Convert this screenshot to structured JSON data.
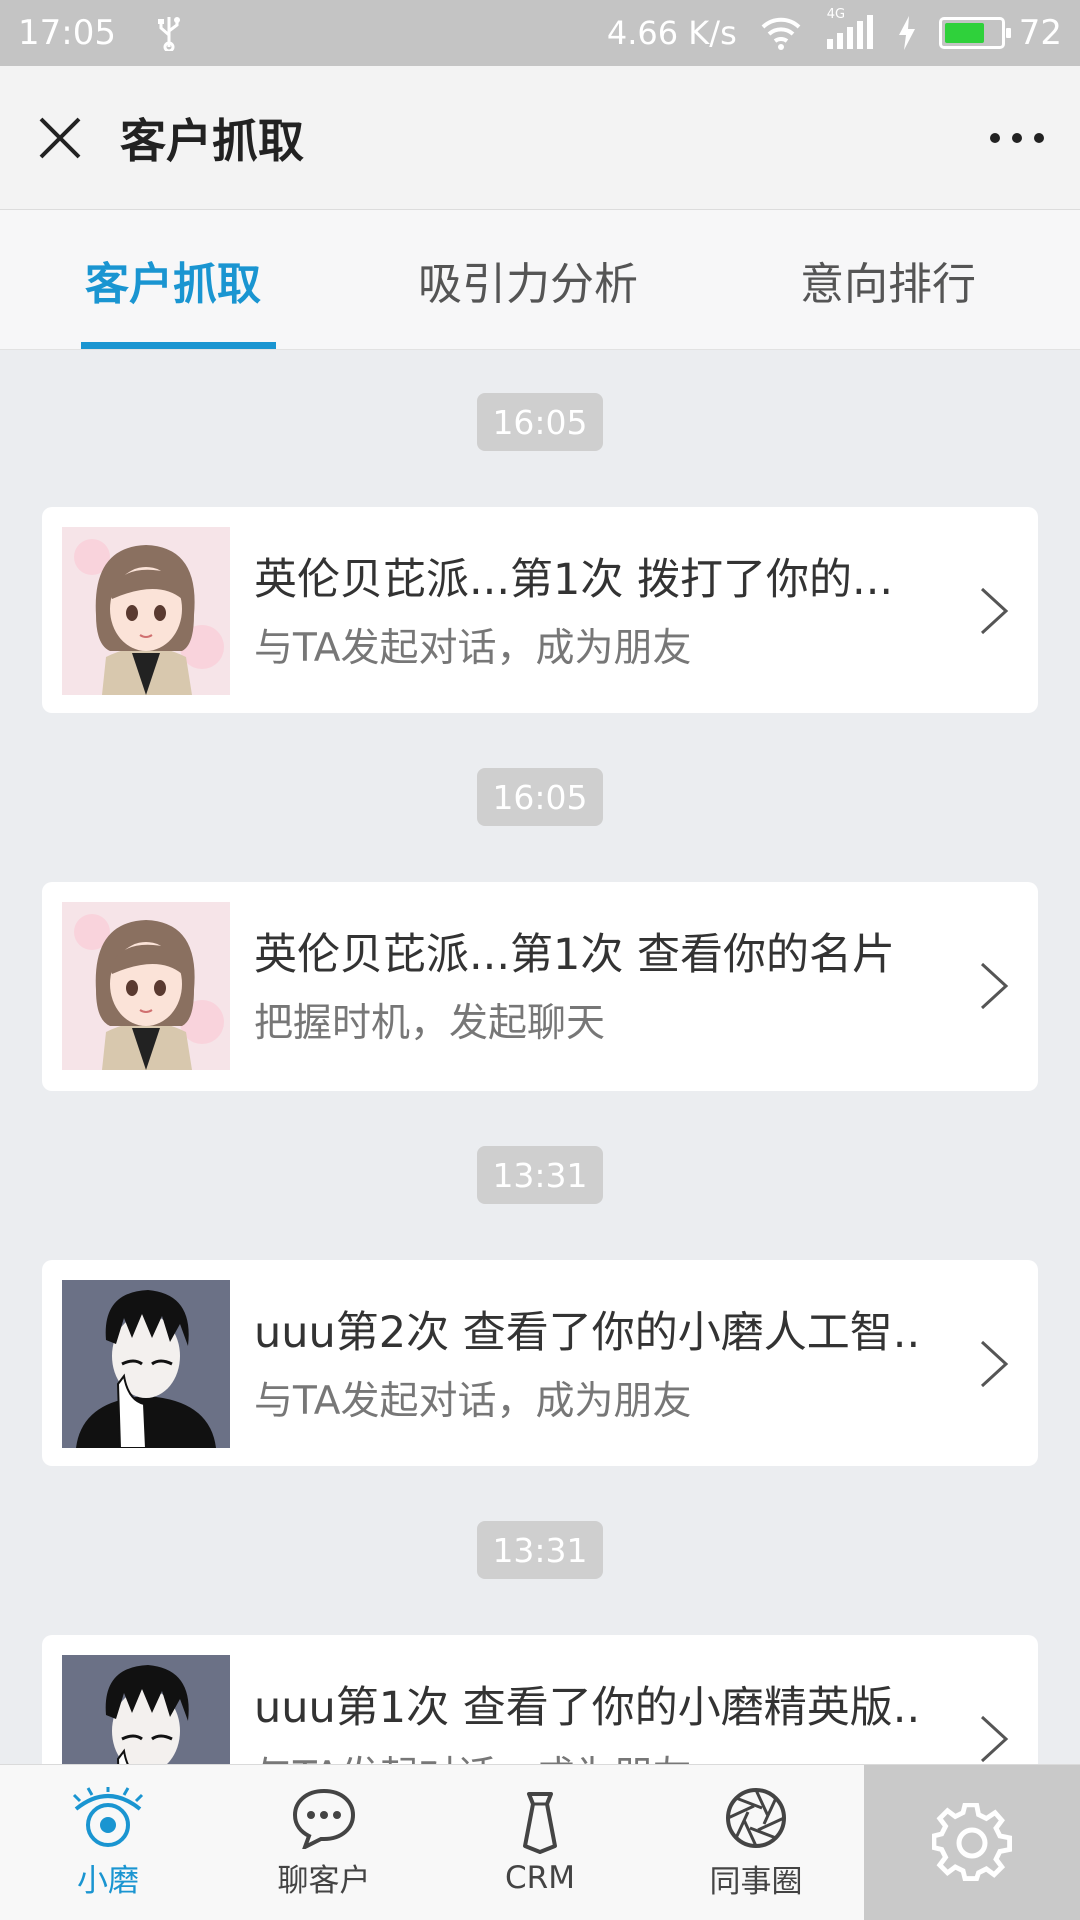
{
  "status_bar": {
    "time": "17:05",
    "net_speed": "4.66 K/s",
    "network_type": "4G",
    "battery": "72",
    "battery_level_percent": 72,
    "icons": [
      "usb-icon",
      "wifi-icon",
      "signal-icon",
      "charging-icon",
      "battery-icon"
    ]
  },
  "header": {
    "title": "客户抓取",
    "close_icon": "close-icon",
    "more_icon": "more-icon"
  },
  "tabs": [
    {
      "label": "客户抓取",
      "active": true
    },
    {
      "label": "吸引力分析",
      "active": false
    },
    {
      "label": "意向排行",
      "active": false
    }
  ],
  "feed": [
    {
      "time": "16:05",
      "title": "英伦贝芘派...第1次 拨打了你的...",
      "subtitle": "与TA发起对话，成为朋友",
      "avatar": "cartoon-girl-avatar"
    },
    {
      "time": "16:05",
      "title": "英伦贝芘派...第1次 查看你的名片",
      "subtitle": "把握时机，发起聊天",
      "avatar": "cartoon-girl-avatar"
    },
    {
      "time": "13:31",
      "title": "uuu第2次 查看了你的小磨人工智..",
      "subtitle": "与TA发起对话，成为朋友",
      "avatar": "cartoon-boy-avatar"
    },
    {
      "time": "13:31",
      "title": "uuu第1次 查看了你的小磨精英版..",
      "subtitle": "与TA发起对话，成为朋友",
      "avatar": "cartoon-boy-avatar"
    }
  ],
  "bottom_nav": [
    {
      "label": "小磨",
      "icon": "eye-icon",
      "active": true
    },
    {
      "label": "聊客户",
      "icon": "chat-bubble-icon",
      "active": false
    },
    {
      "label": "CRM",
      "icon": "tie-icon",
      "active": false
    },
    {
      "label": "同事圈",
      "icon": "aperture-icon",
      "active": false
    }
  ],
  "settings": {
    "icon": "gear-icon"
  },
  "colors": {
    "accent": "#1a95d1",
    "status_bar_bg": "#c4c4c4",
    "page_bg": "#ebedf0",
    "time_pill_bg": "#cfcfcf",
    "battery_fill": "#2fd13b"
  }
}
